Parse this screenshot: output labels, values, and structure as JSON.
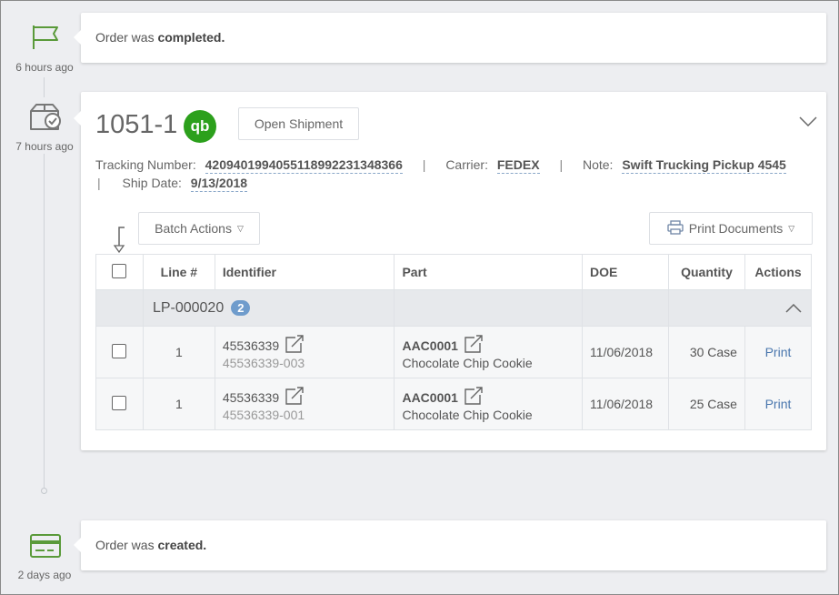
{
  "timeline": [
    {
      "time": "6 hours ago",
      "icon": "flag-icon"
    },
    {
      "time": "7 hours ago",
      "icon": "box-check-icon"
    },
    {
      "time": "2 days ago",
      "icon": "credit-card-icon"
    }
  ],
  "events": {
    "completed": {
      "prefix": "Order was ",
      "bold": "completed."
    },
    "created": {
      "prefix": "Order was ",
      "bold": "created."
    }
  },
  "shipment": {
    "id": "1051-1",
    "qb_logo": "qb",
    "open_button": "Open Shipment",
    "tracking_label": "Tracking Number:",
    "tracking_value": "420940199405511899223134836 6",
    "carrier_label": "Carrier:",
    "carrier_value": "FEDEX",
    "note_label": "Note:",
    "note_value": "Swift Trucking Pickup 4545",
    "sep": "|",
    "ship_date_label": "Ship Date:",
    "ship_date_value": "9/13/2018",
    "batch_actions": "Batch Actions",
    "print_documents": "Print Documents",
    "columns": [
      "Line #",
      "Identifier",
      "Part",
      "DOE",
      "Quantity",
      "Actions"
    ],
    "group": {
      "label": "LP-000020",
      "count": "2"
    },
    "rows": [
      {
        "line": "1",
        "identifier": "45536339",
        "identifier_sub": "45536339-003",
        "part": "AAC0001",
        "part_desc": "Chocolate Chip Cookie",
        "doe": "11/06/2018",
        "quantity": "30 Case",
        "action": "Print"
      },
      {
        "line": "1",
        "identifier": "45536339",
        "identifier_sub": "45536339-001",
        "part": "AAC0001",
        "part_desc": "Chocolate Chip Cookie",
        "doe": "11/06/2018",
        "quantity": "25 Case",
        "action": "Print"
      }
    ]
  },
  "colors": {
    "accent_green": "#5a9a3a",
    "qb_green": "#2ca01c",
    "link_blue": "#4a77ae",
    "badge_blue": "#6f9ccc"
  }
}
